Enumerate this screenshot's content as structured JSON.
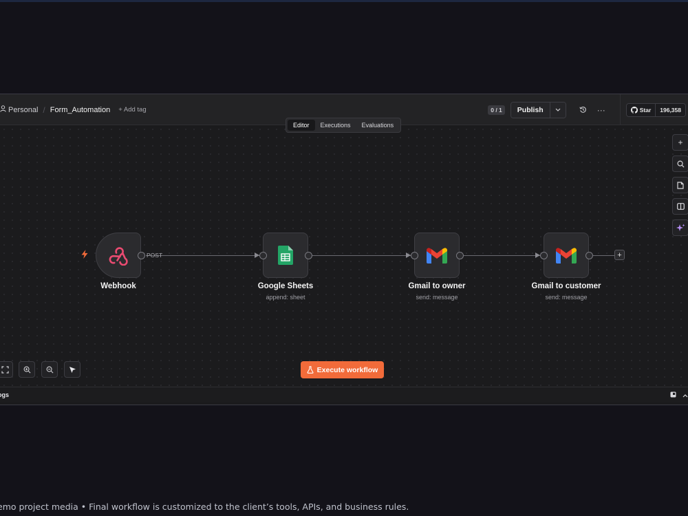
{
  "header": {
    "project": "Personal",
    "workflow_name": "Form_Automation",
    "add_tag": "+ Add tag",
    "version": "0 / 1",
    "publish": "Publish",
    "github_star": "Star",
    "github_count": "196,358"
  },
  "tabs": [
    {
      "label": "Editor",
      "active": true
    },
    {
      "label": "Executions",
      "active": false
    },
    {
      "label": "Evaluations",
      "active": false
    }
  ],
  "nodes": [
    {
      "title": "Webhook",
      "subtitle": "",
      "icon": "webhook-icon",
      "color": "#ea4b71"
    },
    {
      "title": "Google Sheets",
      "subtitle": "append: sheet",
      "icon": "google-sheets-icon",
      "color": "#23a566"
    },
    {
      "title": "Gmail to owner",
      "subtitle": "send: message",
      "icon": "gmail-icon"
    },
    {
      "title": "Gmail to customer",
      "subtitle": "send: message",
      "icon": "gmail-icon"
    }
  ],
  "connections": {
    "webhook_output_label": "POST"
  },
  "side_tools": [
    "plus-icon",
    "search-icon",
    "sticky-note-icon",
    "panel-icon",
    "sparkle-icon"
  ],
  "controls": {
    "execute": "Execute workflow",
    "zoom_tools": [
      "fit-view-icon",
      "zoom-in-icon",
      "zoom-out-icon",
      "cursor-icon"
    ]
  },
  "logs": {
    "label": "ogs"
  },
  "caption": "emo project media • Final workflow is customized to the client’s tools, APIs, and business rules.",
  "colors": {
    "accent": "#f26b3a",
    "background": "#131219",
    "canvas": "#1b1b1d"
  }
}
